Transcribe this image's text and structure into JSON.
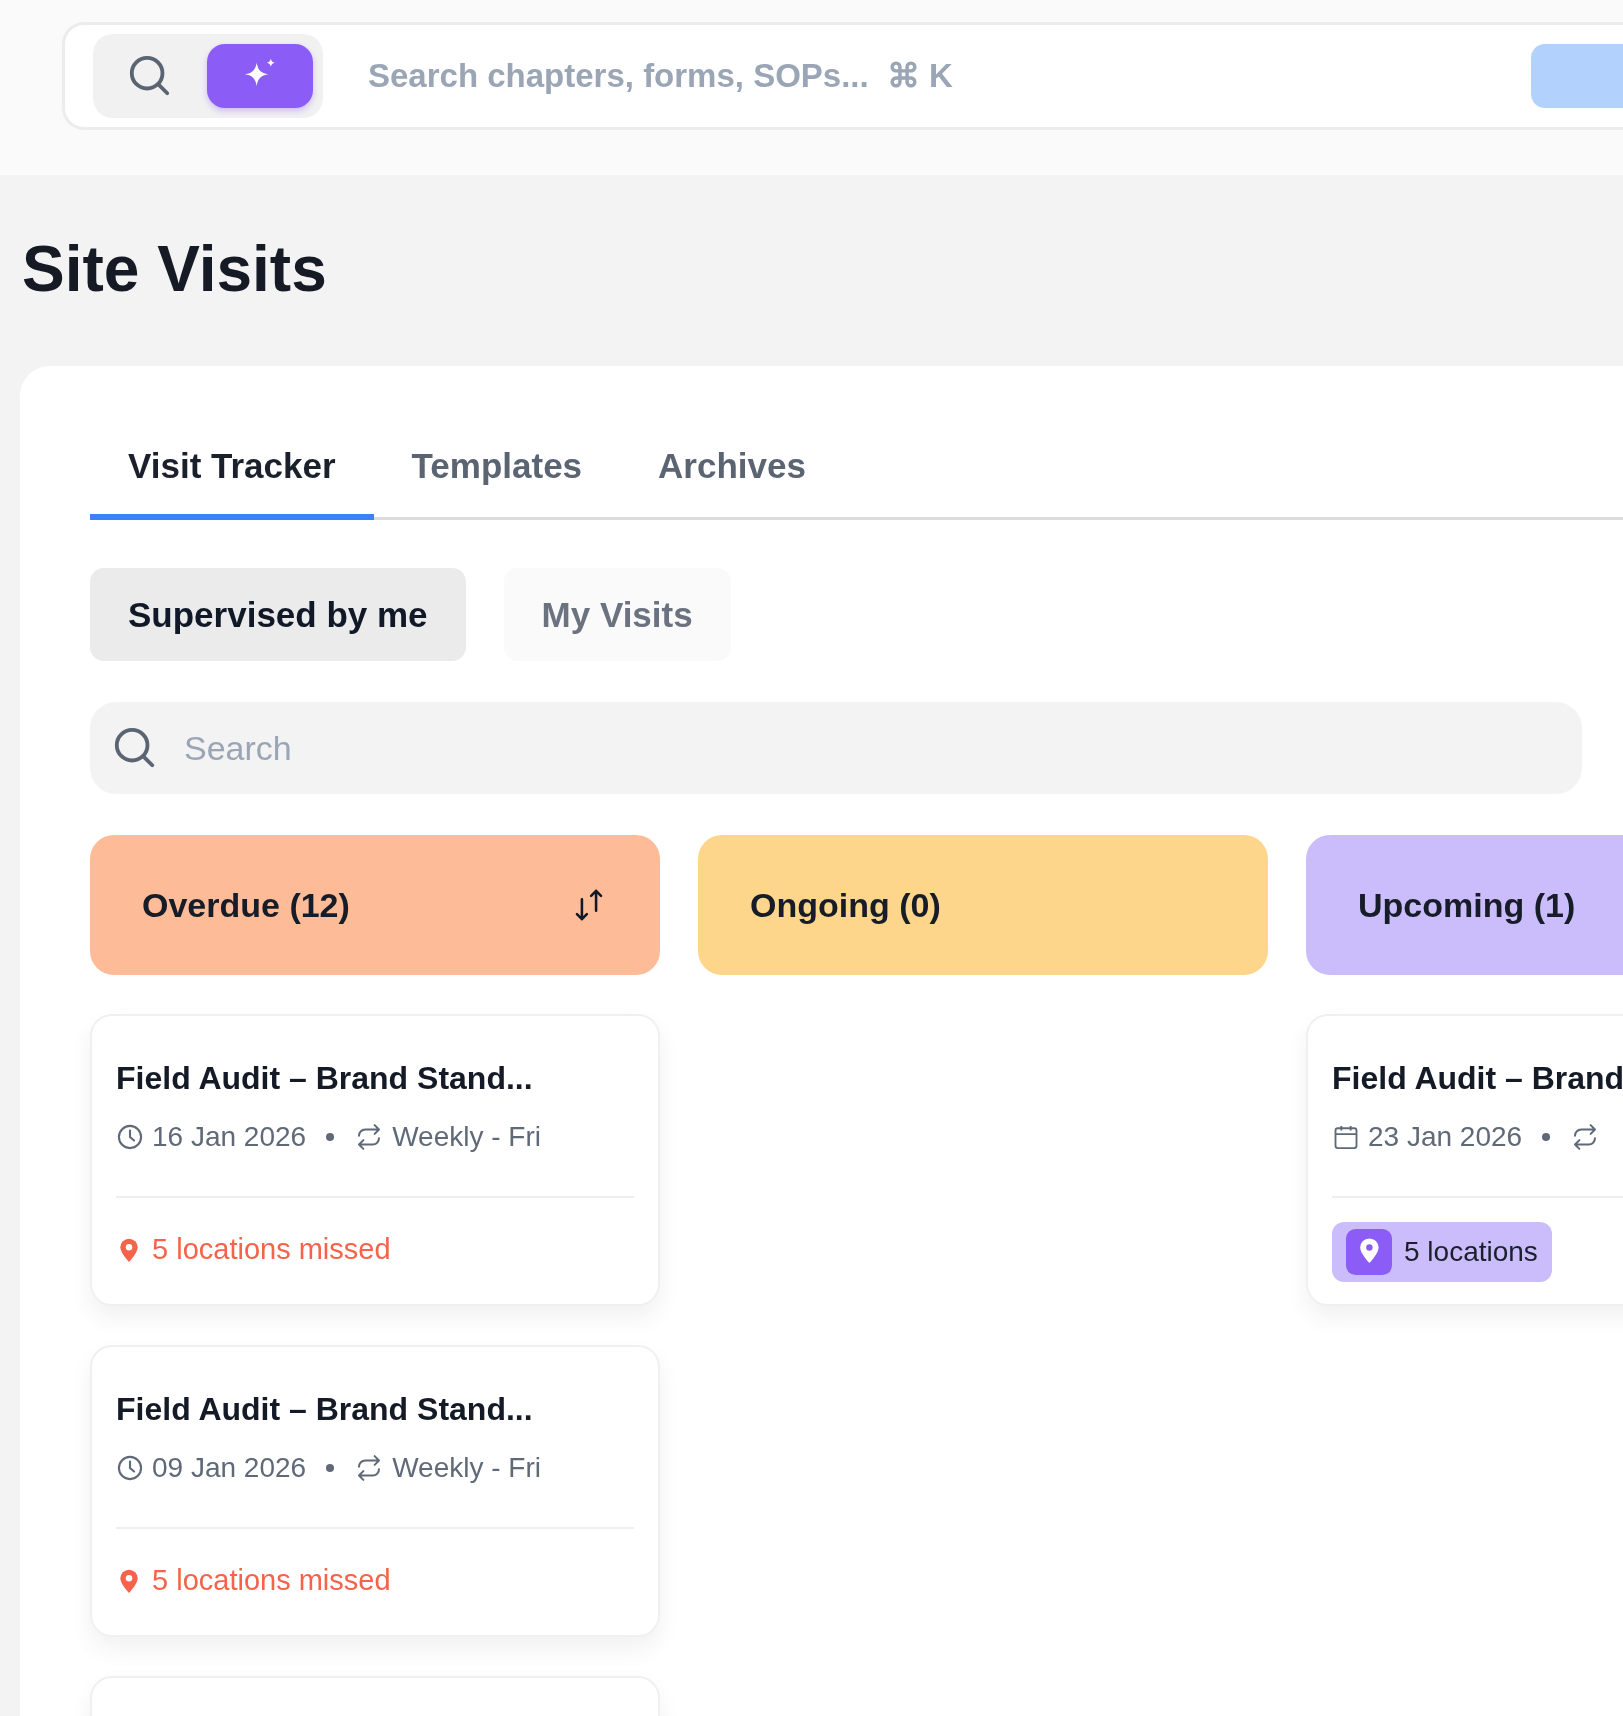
{
  "search_bar": {
    "placeholder": "Search chapters, forms, SOPs...",
    "shortcut": "⌘ K"
  },
  "page_title": "Site Visits",
  "tabs": [
    {
      "label": "Visit Tracker",
      "selected": true
    },
    {
      "label": "Templates",
      "selected": false
    },
    {
      "label": "Archives",
      "selected": false
    }
  ],
  "filters": [
    {
      "label": "Supervised by me",
      "selected": true
    },
    {
      "label": "My Visits",
      "selected": false
    }
  ],
  "search": {
    "placeholder": "Search"
  },
  "columns": [
    {
      "title": "Overdue (12)",
      "color": "#fdbb98",
      "sortable": true,
      "cards": [
        {
          "kind": "missed",
          "title": "Field Audit – Brand Stand...",
          "date": "16 Jan 2026",
          "recurrence": "Weekly - Fri",
          "locations": "5 locations missed"
        },
        {
          "kind": "missed",
          "title": "Field Audit – Brand Stand...",
          "date": "09 Jan 2026",
          "recurrence": "Weekly - Fri",
          "locations": "5 locations missed"
        },
        {
          "kind": "blank"
        }
      ]
    },
    {
      "title": "Ongoing (0)",
      "color": "#fed68b",
      "sortable": false
    },
    {
      "title": "Upcoming (1)",
      "color": "#cbbdfb",
      "sortable": false,
      "cards": [
        {
          "kind": "scheduled",
          "title": "Field Audit – Brand",
          "date": "23 Jan 2026",
          "locations": "5 locations"
        }
      ]
    }
  ]
}
